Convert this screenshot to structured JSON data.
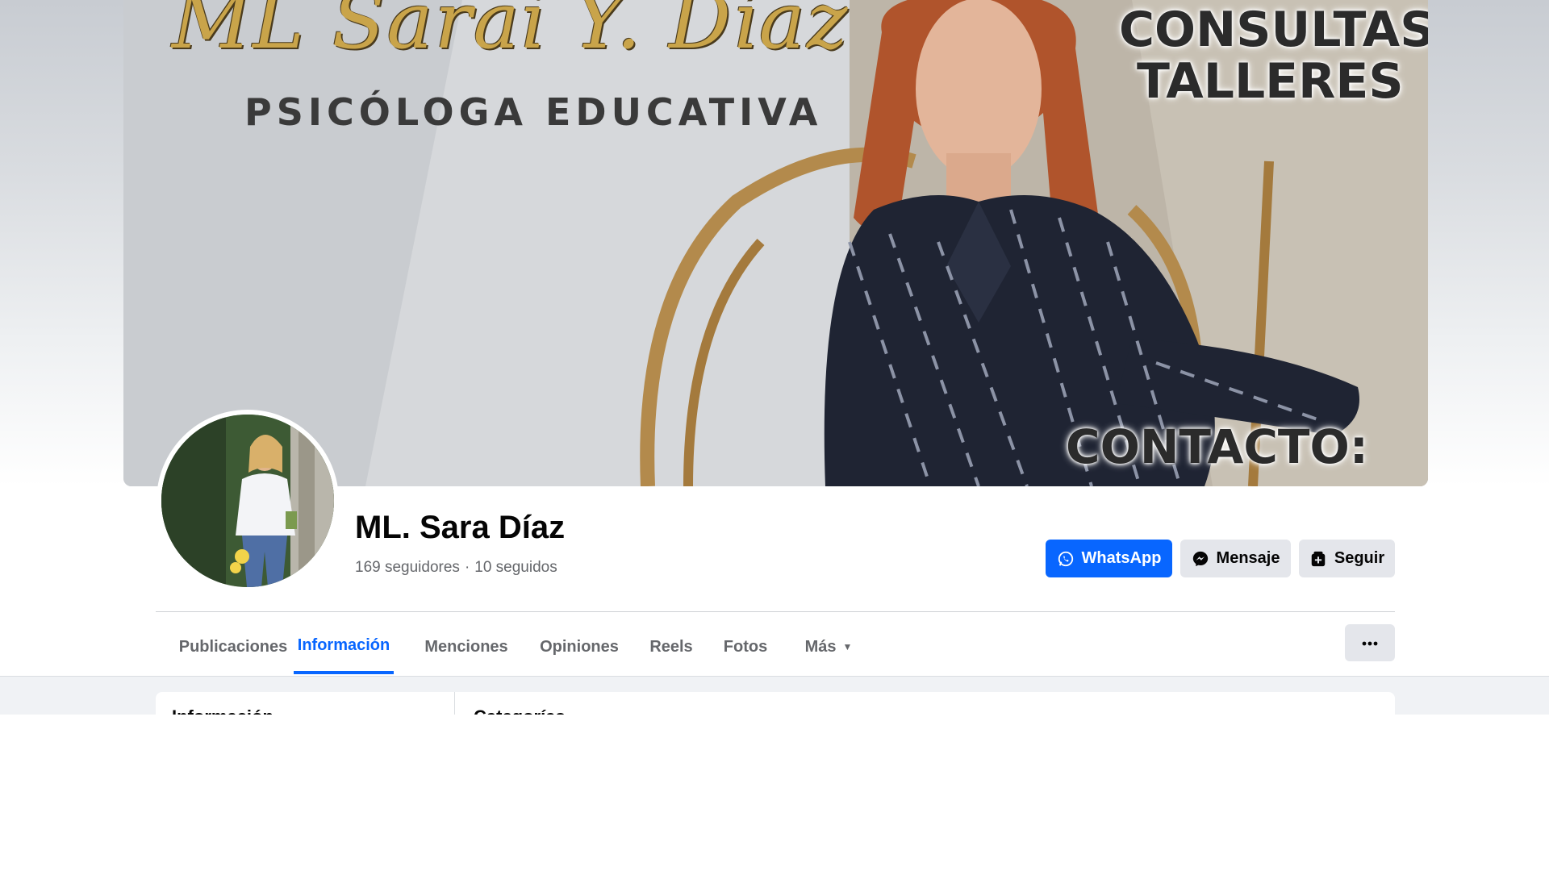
{
  "cover": {
    "signature_text": "ML Sarai Y. Díaz",
    "subtitle": "PSICÓLOGA EDUCATIVA",
    "tag_line_1": "CONSULTAS",
    "tag_line_2": "TALLERES",
    "tag_line_3": "CONTACTO:"
  },
  "profile": {
    "name": "ML. Sara Díaz",
    "followers": "169 seguidores",
    "separator": "·",
    "following": "10 seguidos"
  },
  "actions": {
    "whatsapp_label": "WhatsApp",
    "message_label": "Mensaje",
    "follow_label": "Seguir"
  },
  "tabs": [
    {
      "label": "Publicaciones",
      "active": false
    },
    {
      "label": "Información",
      "active": true
    },
    {
      "label": "Menciones",
      "active": false
    },
    {
      "label": "Opiniones",
      "active": false
    },
    {
      "label": "Reels",
      "active": false
    },
    {
      "label": "Fotos",
      "active": false
    },
    {
      "label": "Más",
      "active": false
    }
  ],
  "content": {
    "left_heading": "Información",
    "right_heading": "Categorías"
  },
  "colors": {
    "accent": "#0866ff",
    "secondary_button": "#e4e6eb",
    "muted_text": "#65676b",
    "page_background": "#f0f2f5"
  },
  "icons": {
    "whatsapp": "whatsapp-icon",
    "messenger": "messenger-icon",
    "follow": "follow-icon",
    "more": "more-dots-icon",
    "caret": "caret-down-icon"
  }
}
